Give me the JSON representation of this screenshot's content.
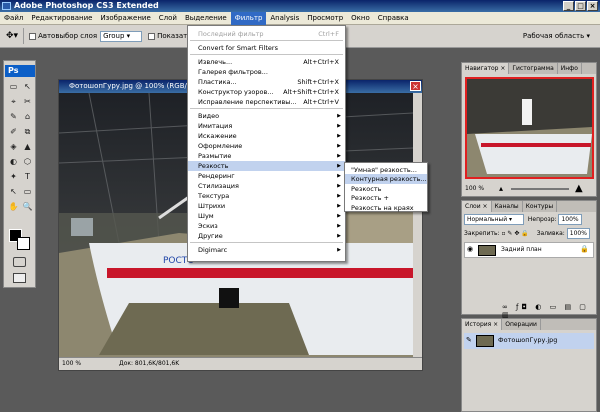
{
  "titlebar": {
    "title": "Adobe Photoshop CS3 Extended"
  },
  "menu": {
    "items": [
      "Файл",
      "Редактирование",
      "Изображение",
      "Слой",
      "Выделение",
      "Фильтр",
      "Analysis",
      "Просмотр",
      "Окно",
      "Справка"
    ],
    "active_index": 5
  },
  "options": {
    "auto_select_label": "Автовыбор слоя",
    "group_value": "Group",
    "show_label": "Показать уп",
    "workspace_label": "Рабочая область ▾"
  },
  "document": {
    "title": "ФотошопГуру.jpg @ 100% (RGB/8#)",
    "zoom": "100 %",
    "doc_size": "Док: 801,6K/801,6K",
    "plane_text": "РОСТО"
  },
  "filter_menu": {
    "items": [
      {
        "label": "Последний фильтр",
        "shortcut": "Ctrl+F",
        "disabled": true
      },
      {
        "label": "Convert for Smart Filters"
      },
      {
        "label": "Извлечь...",
        "shortcut": "Alt+Ctrl+X"
      },
      {
        "label": "Галерея фильтров..."
      },
      {
        "label": "Пластика...",
        "shortcut": "Shift+Ctrl+X"
      },
      {
        "label": "Конструктор узоров...",
        "shortcut": "Alt+Shift+Ctrl+X"
      },
      {
        "label": "Исправление перспективы...",
        "shortcut": "Alt+Ctrl+V"
      },
      {
        "label": "Видео",
        "submenu": true
      },
      {
        "label": "Имитация",
        "submenu": true
      },
      {
        "label": "Искажение",
        "submenu": true
      },
      {
        "label": "Оформление",
        "submenu": true
      },
      {
        "label": "Размытие",
        "submenu": true
      },
      {
        "label": "Резкость",
        "submenu": true,
        "highlighted": true
      },
      {
        "label": "Рендеринг",
        "submenu": true
      },
      {
        "label": "Стилизация",
        "submenu": true
      },
      {
        "label": "Текстура",
        "submenu": true
      },
      {
        "label": "Штрихи",
        "submenu": true
      },
      {
        "label": "Шум",
        "submenu": true
      },
      {
        "label": "Эскиз",
        "submenu": true
      },
      {
        "label": "Другие",
        "submenu": true
      },
      {
        "label": "Digimarc",
        "submenu": true
      }
    ]
  },
  "sharpen_submenu": {
    "items": [
      "\"Умная\" резкость...",
      "Контурная резкость...",
      "Резкость",
      "Резкость +",
      "Резкость на краях"
    ],
    "highlighted_index": 1
  },
  "navigator": {
    "tabs": [
      "Навигатор ×",
      "Гистограмма",
      "Инфо"
    ],
    "zoom": "100 %"
  },
  "layers": {
    "tabs": [
      "Слои ×",
      "Каналы",
      "Контуры"
    ],
    "blend_mode": "Нормальный",
    "opacity_label": "Непрозр:",
    "opacity": "100%",
    "lock_label": "Закрепить:",
    "fill_label": "Заливка:",
    "fill": "100%",
    "layer_name": "Задний план"
  },
  "history": {
    "tabs": [
      "История ×",
      "Операции"
    ],
    "snapshot_name": "ФотошопГуру.jpg"
  },
  "colors": {
    "menu_highlight": "#316ac5",
    "item_highlight": "#c1d2ee",
    "title_gradient_start": "#0a246a",
    "plane_stripe": "#c8162a"
  }
}
